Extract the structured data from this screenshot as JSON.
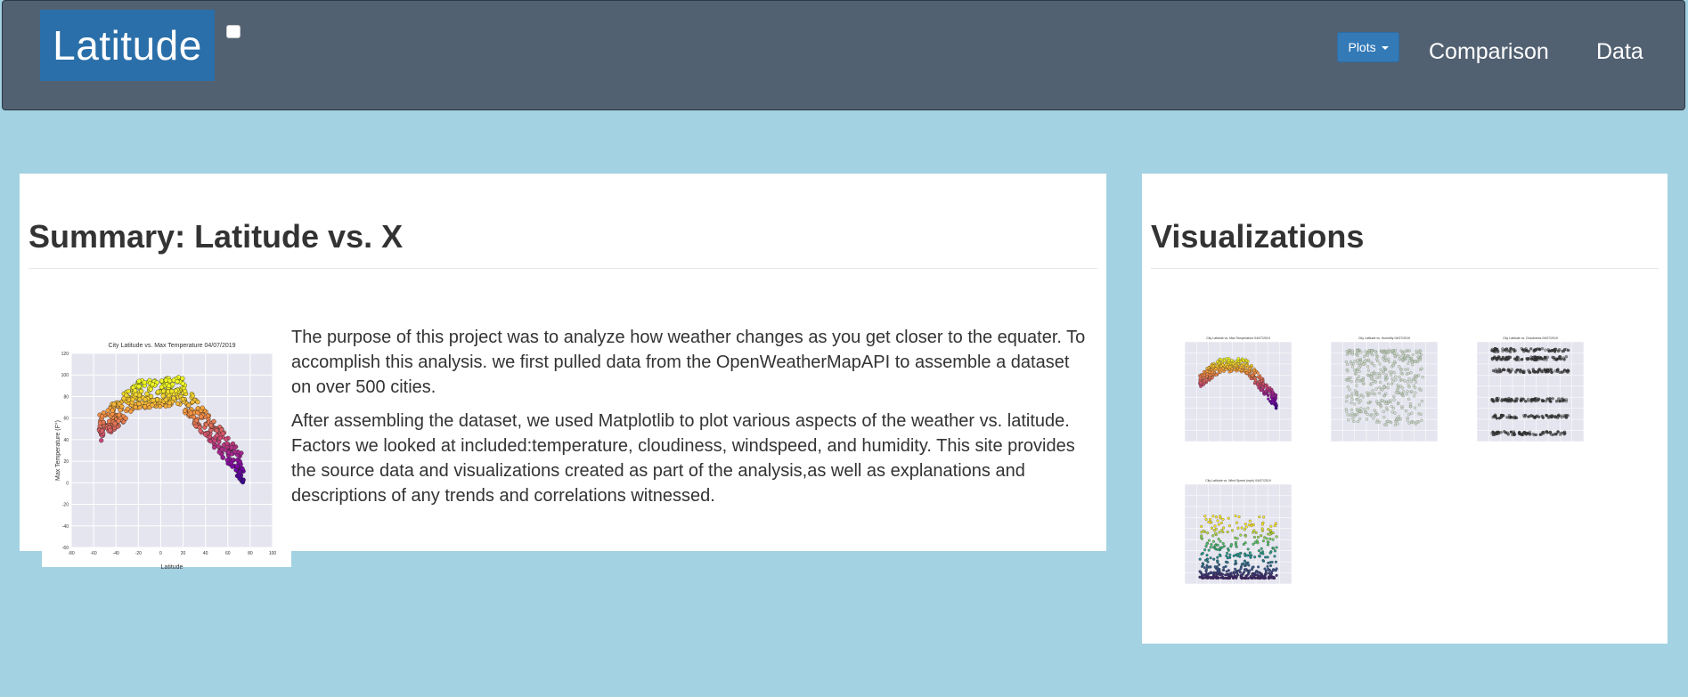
{
  "navbar": {
    "brand": "Latitude",
    "dropdown_label": "Plots",
    "links": [
      "Comparison",
      "Data"
    ]
  },
  "summary": {
    "title": "Summary: Latitude vs. X",
    "paragraphs": [
      "The purpose of this project was to analyze how weather changes as you get closer to the equater. To accomplish this analysis. we first pulled data from the OpenWeatherMapAPI to assemble a dataset on over 500 cities.",
      "After assembling the dataset, we used Matplotlib to plot various aspects of the weather vs. latitude. Factors we looked at included:temperature, cloudiness, windspeed, and humidity. This site provides the source data and visualizations created as part of the analysis,as well as explanations and descriptions of any trends and correlations witnessed."
    ],
    "plot": {
      "title": "City Latitude vs. Max Temperature 04/07/2019",
      "xlabel": "Latitude",
      "ylabel": "Max Temperature (F°)",
      "xticks": [
        "-80",
        "-60",
        "-40",
        "-20",
        "0",
        "20",
        "40",
        "60",
        "80",
        "100"
      ],
      "yticks": [
        "120",
        "100",
        "80",
        "60",
        "40",
        "20",
        "0",
        "-20",
        "-40",
        "-60"
      ]
    }
  },
  "visualizations": {
    "title": "Visualizations",
    "thumbs": [
      "City Latitude vs. Max Temperature 04/07/2019",
      "City Latitude vs. Humidity 04/07/2019",
      "City Latitude vs. Cloudiness 04/07/2019",
      "City Latitude vs. Wind Speed (mph) 04/07/2019"
    ]
  }
}
